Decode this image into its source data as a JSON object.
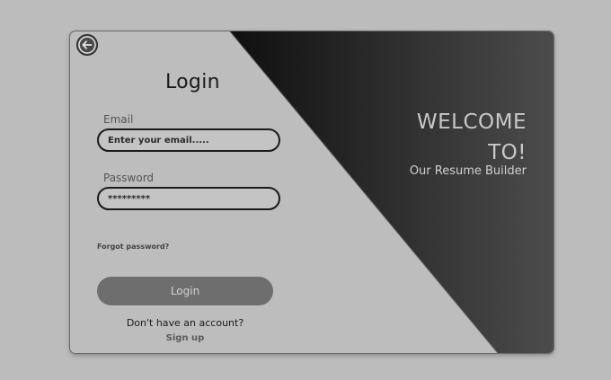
{
  "login": {
    "title": "Login",
    "email_label": "Email",
    "email_placeholder": "Enter your email.....",
    "password_label": "Password",
    "password_value": "*********",
    "forgot_password": "Forgot password?",
    "login_button": "Login",
    "no_account": "Don't have an account?",
    "signup_link": "Sign up"
  },
  "welcome": {
    "heading": "WELCOME TO!",
    "subtitle": "Our Resume Builder"
  },
  "colors": {
    "page_background": "#bcbcbc",
    "card_background": "#bdbdbd",
    "dark_panel_start": "#0f0f0f",
    "dark_panel_end": "#4c4c4c",
    "button": "#6e6e6e"
  },
  "icons": {
    "back": "arrow-left-icon"
  }
}
